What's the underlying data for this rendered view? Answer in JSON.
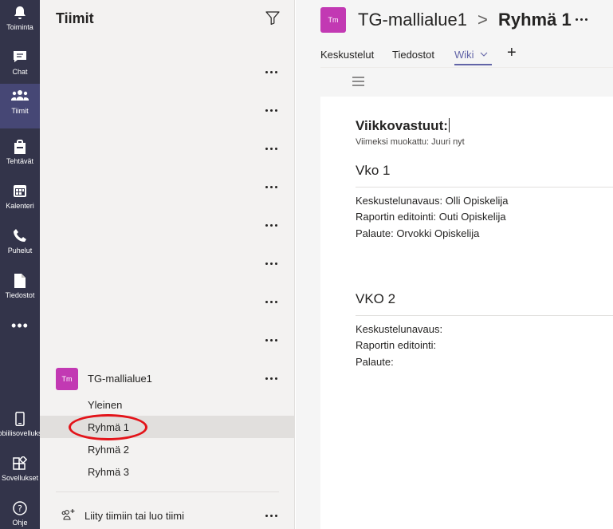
{
  "rail": {
    "items": [
      {
        "label": "Toiminta",
        "icon": "bell-icon"
      },
      {
        "label": "Chat",
        "icon": "chat-icon"
      },
      {
        "label": "Tiimit",
        "icon": "teams-icon"
      },
      {
        "label": "Tehtävät",
        "icon": "assignments-icon"
      },
      {
        "label": "Kalenteri",
        "icon": "calendar-icon"
      },
      {
        "label": "Puhelut",
        "icon": "phone-icon"
      },
      {
        "label": "Tiedostot",
        "icon": "files-icon"
      }
    ],
    "more": "•••",
    "bottom": [
      {
        "label": "Mobiilisovellukset",
        "icon": "mobile-icon"
      },
      {
        "label": "Sovellukset",
        "icon": "apps-icon"
      },
      {
        "label": "Ohje",
        "icon": "help-icon"
      }
    ]
  },
  "panel": {
    "title": "Tiimit",
    "team": {
      "avatar": "Tm",
      "name": "TG-mallialue1",
      "channels": [
        "Yleinen",
        "Ryhmä 1",
        "Ryhmä 2",
        "Ryhmä 3"
      ],
      "selected_channel": "Ryhmä 1"
    },
    "join": "Liity tiimiin tai luo tiimi"
  },
  "header": {
    "avatar": "Tm",
    "team": "TG-mallialue1",
    "separator": ">",
    "channel": "Ryhmä 1",
    "tabs": [
      "Keskustelut",
      "Tiedostot",
      "Wiki"
    ],
    "active_tab": "Wiki",
    "add": "+"
  },
  "wiki": {
    "title": "Viikkovastuut:",
    "meta": "Viimeksi muokattu: Juuri nyt",
    "sections": [
      {
        "title": "Vko 1",
        "lines": [
          "Keskustelunavaus: Olli Opiskelija",
          "Raportin editointi: Outi Opiskelija",
          "Palaute: Orvokki Opiskelija"
        ]
      },
      {
        "title": "VKO 2",
        "lines": [
          "Keskustelunavaus:",
          "Raportin editointi:",
          "Palaute:"
        ]
      }
    ]
  },
  "colors": {
    "rail": "#33344a",
    "rail_active": "#464775",
    "accent": "#6264a7",
    "avatar": "#c239b3",
    "highlight_ring": "#e3141a"
  }
}
